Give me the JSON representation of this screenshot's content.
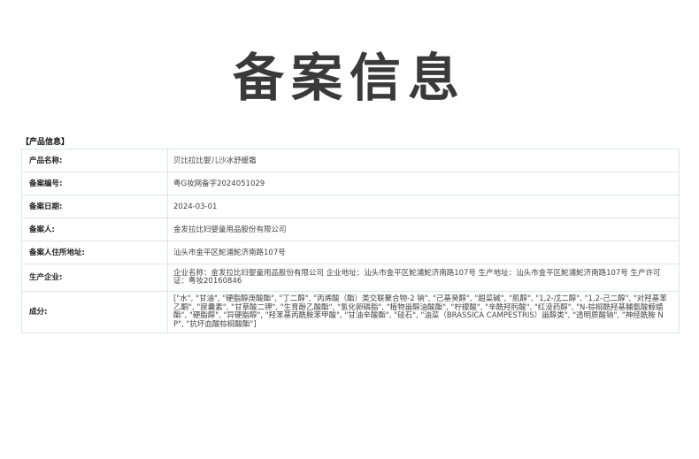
{
  "page": {
    "title": "备案信息"
  },
  "section": {
    "label": "【产品信息】"
  },
  "rows": [
    {
      "label": "产品名称:",
      "value": "贝比拉比婴儿沙冰舒缓霜"
    },
    {
      "label": "备案编号:",
      "value": "粤G妆网备字2024051029"
    },
    {
      "label": "备案日期:",
      "value": "2024-03-01"
    },
    {
      "label": "备案人:",
      "value": "金发拉比妇婴童用品股份有限公司"
    },
    {
      "label": "备案人住所地址:",
      "value": "汕头市金平区鮀浦鮀济南路107号"
    },
    {
      "label": "生产企业:",
      "value": "企业名称：金发拉比妇婴童用品股份有限公司 企业地址：汕头市金平区鮀浦鮀济南路107号 生产地址：汕头市金平区鮀浦鮀济南路107号 生产许可证：粤妆20160846"
    },
    {
      "label": "成分:",
      "value": "[\"水\", \"甘油\", \"硬脂醇庚酸酯\", \"丁二醇\", \"丙烯酸（酯）类交联聚合物-2 钠\", \"己基癸醇\", \"甜菜碱\", \"肌醇\", \"1,2-戊二醇\", \"1,2-己二醇\", \"对羟基苯乙酮\", \"尿囊素\", \"甘草酸二钾\", \"生育酚乙酸酯\", \"氢化卵磷脂\", \"植物甾醇油酸酯\", \"柠檬酸\", \"辛酰羟肟酸\", \"红没药醇\", \"N-棕榈酰羟基脯氨酸鲸蜡酯\", \"硬脂醇\", \"异硬脂醇\", \"羟苯基丙酰胺苯甲酸\", \"甘油辛酸酯\", \"硅石\", \"油菜（BRASSICA CAMPESTRIS）甾醇类\", \"透明质酸钠\", \"神经酰胺 NP\", \"抗坏血酸棕榈酸酯\"]"
    }
  ]
}
